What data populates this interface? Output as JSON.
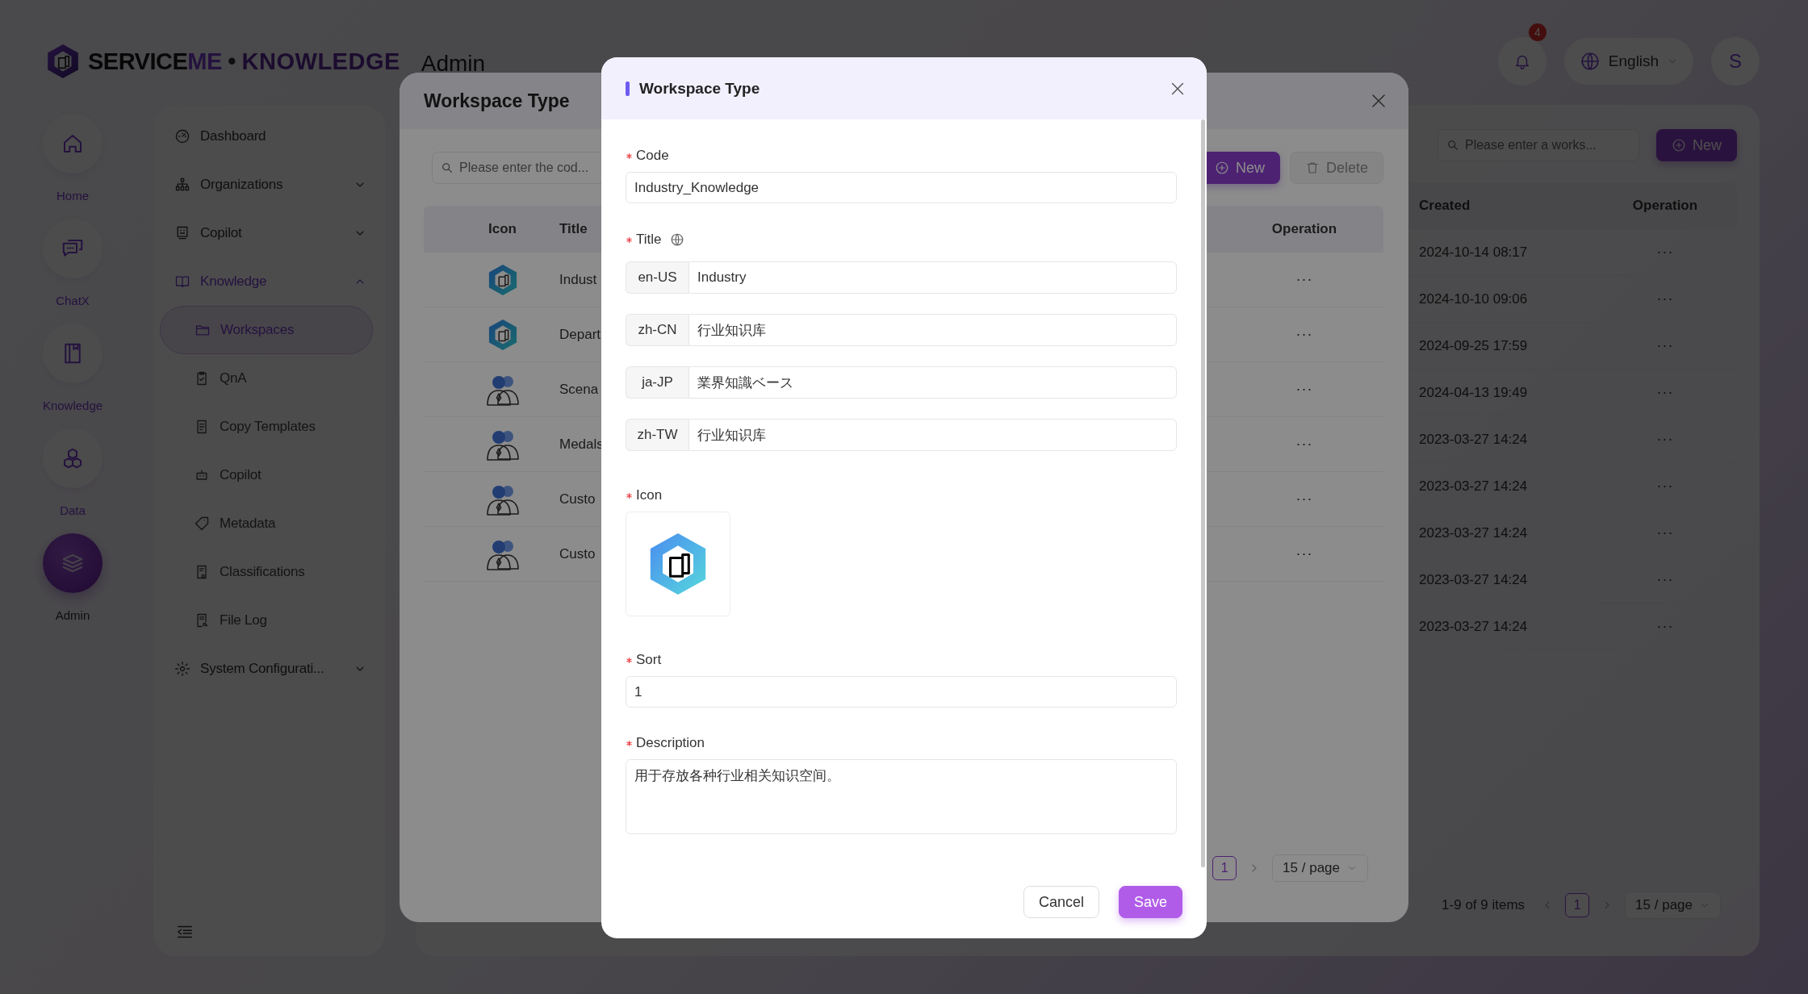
{
  "header": {
    "logo": {
      "brand": "SERVICE",
      "accent": "ME",
      "separator": "•",
      "product": "KNOWLEDGE"
    },
    "section": "Admin",
    "notifications": "4",
    "language": "English",
    "avatar": "S"
  },
  "rail": [
    {
      "label": "Home",
      "selected": false
    },
    {
      "label": "ChatX",
      "selected": false
    },
    {
      "label": "Knowledge",
      "selected": false
    },
    {
      "label": "Data",
      "selected": false
    },
    {
      "label": "Admin",
      "selected": true
    }
  ],
  "sidebar": {
    "items": [
      {
        "label": "Dashboard",
        "selected": false
      },
      {
        "label": "Organizations",
        "selected": false,
        "expanded": false
      },
      {
        "label": "Copilot",
        "selected": false,
        "expanded": false
      },
      {
        "label": "Knowledge",
        "selected": true,
        "expanded": true,
        "children": [
          {
            "label": "Workspaces",
            "selected": true
          },
          {
            "label": "QnA",
            "selected": false
          },
          {
            "label": "Copy Templates",
            "selected": false
          },
          {
            "label": "Copilot",
            "selected": false
          },
          {
            "label": "Metadata",
            "selected": false
          },
          {
            "label": "Classifications",
            "selected": false
          },
          {
            "label": "File Log",
            "selected": false
          }
        ]
      },
      {
        "label": "System Configurati...",
        "selected": false,
        "expanded": false
      }
    ]
  },
  "page": {
    "search": {
      "placeholder": "Please enter a works..."
    },
    "new_button": "New",
    "table": {
      "columns": [
        "Created",
        "Operation"
      ],
      "rows": [
        {
          "created": "2024-10-14 08:17",
          "operation": "···"
        },
        {
          "created": "2024-10-10 09:06",
          "operation": "···"
        },
        {
          "created": "2024-09-25 17:59",
          "operation": "···"
        },
        {
          "created": "2024-04-13 19:49",
          "operation": "···"
        },
        {
          "created": "2023-03-27 14:24",
          "operation": "···"
        },
        {
          "created": "2023-03-27 14:24",
          "operation": "···"
        },
        {
          "created": "2023-03-27 14:24",
          "operation": "···"
        },
        {
          "created": "2023-03-27 14:24",
          "operation": "···"
        },
        {
          "created": "2023-03-27 14:24",
          "operation": "···"
        }
      ]
    },
    "pagination": {
      "summary": "1-9 of 9 items",
      "pages": [
        {
          "label": "1",
          "selected": true
        }
      ],
      "page_size": "15 / page"
    }
  },
  "workspace_type_dialog": {
    "title": "Workspace Type",
    "search": {
      "placeholder": "Please enter the cod..."
    },
    "buttons": [
      {
        "label": "New",
        "kind": "add",
        "disabled": false
      },
      {
        "label": "Delete",
        "kind": "delete",
        "disabled": true
      }
    ],
    "table": {
      "columns": [
        "Icon",
        "Title",
        "Operation"
      ],
      "rows": [
        {
          "kind": "cube",
          "title": "Indust",
          "operation": "···"
        },
        {
          "kind": "cube",
          "title": "Depart",
          "operation": "···"
        },
        {
          "kind": "people",
          "title": "Scena",
          "operation": "···"
        },
        {
          "kind": "people",
          "title": "Medals",
          "operation": "···"
        },
        {
          "kind": "people",
          "title": "Custo",
          "operation": "···"
        },
        {
          "kind": "people",
          "title": "Custo",
          "operation": "···"
        }
      ]
    },
    "pagination": {
      "pages": [
        {
          "label": "1",
          "selected": true
        }
      ],
      "page_size": "15 / page"
    }
  },
  "edit_dialog": {
    "title": "Workspace Type",
    "fields": [
      {
        "kind": "text",
        "label": "Code",
        "required": true,
        "value": "Industry_Knowledge"
      },
      {
        "kind": "translations",
        "label": "Title",
        "required": true,
        "rows": [
          {
            "locale": "en-US",
            "value": "Industry"
          },
          {
            "locale": "zh-CN",
            "value": "行业知识库"
          },
          {
            "locale": "ja-JP",
            "value": "業界知識ベース"
          },
          {
            "locale": "zh-TW",
            "value": "行业知识库"
          }
        ]
      },
      {
        "kind": "icon",
        "label": "Icon",
        "required": true
      },
      {
        "kind": "text",
        "label": "Sort",
        "required": true,
        "value": "1"
      },
      {
        "kind": "textarea",
        "label": "Description",
        "required": true,
        "value": "用于存放各种行业相关知识空间。"
      }
    ],
    "buttons": [
      {
        "label": "Cancel",
        "kind": "default"
      },
      {
        "label": "Save",
        "kind": "primary"
      }
    ]
  }
}
